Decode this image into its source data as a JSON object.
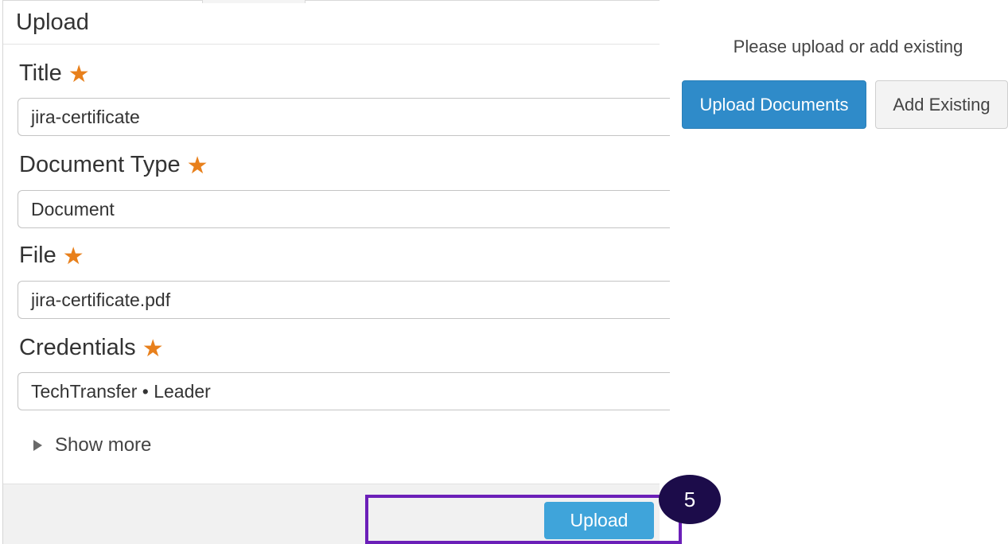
{
  "dialog": {
    "title": "Upload",
    "fields": [
      {
        "label": "Title",
        "value": "jira-certificate"
      },
      {
        "label": "Document Type",
        "value": "Document"
      },
      {
        "label": "File",
        "value": "jira-certificate.pdf"
      },
      {
        "label": "Credentials",
        "value": "TechTransfer • Leader"
      }
    ],
    "required_marker": "★",
    "show_more_label": "Show more",
    "upload_button_label": "Upload"
  },
  "right_panel": {
    "hint": "Please upload or add existing",
    "upload_documents_label": "Upload Documents",
    "add_existing_label": "Add Existing"
  },
  "overlay": {
    "step_number": "5"
  },
  "colors": {
    "accent_blue": "#2f8bc9",
    "upload_blue": "#3fa4da",
    "required_star": "#e8801c",
    "highlight_purple": "#6b1fb8",
    "badge_navy": "#1c0c4a"
  }
}
